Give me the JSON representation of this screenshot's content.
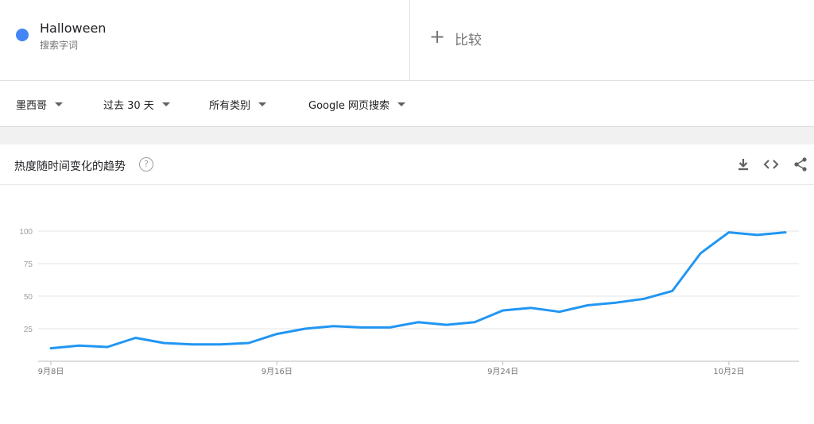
{
  "search_term": {
    "title": "Halloween",
    "subtitle": "搜索字词",
    "color": "#4285f4"
  },
  "compare": {
    "plus": "+",
    "label": "比较"
  },
  "filters": {
    "region": "墨西哥",
    "time": "过去 30 天",
    "category": "所有类别",
    "property": "Google 网页搜索"
  },
  "card": {
    "title": "热度随时间变化的趋势",
    "help": "?",
    "icons": [
      "download-icon",
      "embed-icon",
      "share-icon"
    ]
  },
  "chart_data": {
    "type": "line",
    "color": "#2196f3",
    "y_ticks": [
      "25",
      "50",
      "75",
      "100"
    ],
    "ylim": [
      0,
      100
    ],
    "x_tick_labels": [
      "9月8日",
      "9月16日",
      "9月24日",
      "10月2日"
    ],
    "x_tick_indices": [
      0,
      8,
      16,
      24
    ],
    "x": [
      "9月8日",
      "9月9日",
      "9月10日",
      "9月11日",
      "9月12日",
      "9月13日",
      "9月14日",
      "9月15日",
      "9月16日",
      "9月17日",
      "9月18日",
      "9月19日",
      "9月20日",
      "9月21日",
      "9月22日",
      "9月23日",
      "9月24日",
      "9月25日",
      "9月26日",
      "9月27日",
      "9月28日",
      "9月29日",
      "9月30日",
      "10月1日",
      "10月2日",
      "10月3日",
      "10月4日"
    ],
    "values": [
      10,
      12,
      11,
      18,
      14,
      13,
      13,
      14,
      21,
      25,
      27,
      26,
      26,
      30,
      28,
      30,
      39,
      41,
      38,
      43,
      45,
      48,
      54,
      83,
      99,
      97,
      99
    ]
  }
}
